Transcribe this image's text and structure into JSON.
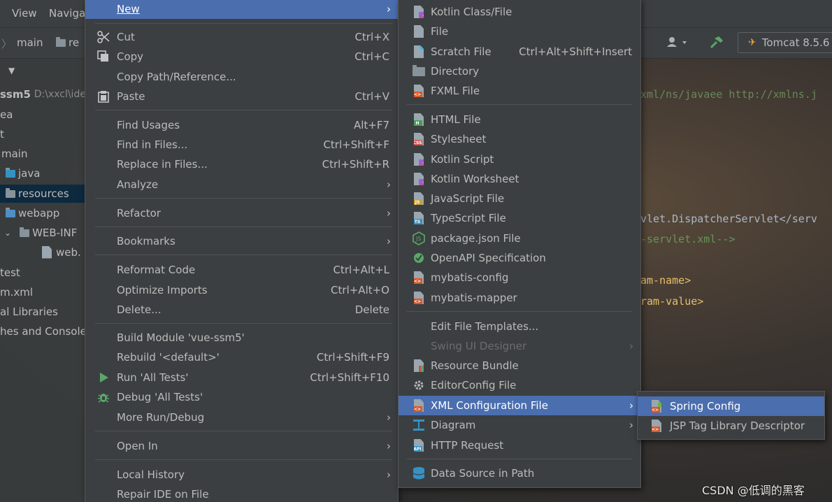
{
  "ide": {
    "menubar": {
      "view": "View",
      "navigate": "Naviga"
    },
    "breadcrumb": {
      "main": "main",
      "resources": "re"
    },
    "run_config": "Tomcat 8.5.6",
    "project_tree": [
      {
        "label": "ssm5",
        "hint": "D:\\xxcl\\idea"
      },
      {
        "label": "ea"
      },
      {
        "label": "t"
      },
      {
        "label": "main"
      },
      {
        "label": "java"
      },
      {
        "label": "resources"
      },
      {
        "label": "webapp"
      },
      {
        "label": "WEB-INF"
      },
      {
        "label": "web."
      },
      {
        "label": "test"
      },
      {
        "label": "m.xml"
      },
      {
        "label": "al Libraries"
      },
      {
        "label": "hes and Console"
      }
    ],
    "code_lines": [
      {
        "text": "xml/ns/javaee http://xmlns.j",
        "cls": "c-str"
      },
      {
        "text": "vlet.DispatcherServlet</serv",
        "cls": "c-txt"
      },
      {
        "text": "-servlet.xml-->",
        "cls": "c-com"
      },
      {
        "text": "am-name>",
        "cls": "c-tag"
      },
      {
        "text": "ram-value>",
        "cls": "c-tag"
      }
    ]
  },
  "context_menu": {
    "items": [
      {
        "label": "New",
        "submenu": true
      },
      {
        "label": "Cut",
        "shortcut": "Ctrl+X",
        "icon": "scissors-icon"
      },
      {
        "label": "Copy",
        "shortcut": "Ctrl+C",
        "icon": "copy-icon"
      },
      {
        "label": "Copy Path/Reference..."
      },
      {
        "label": "Paste",
        "shortcut": "Ctrl+V",
        "icon": "paste-icon"
      },
      {
        "label": "Find Usages",
        "shortcut": "Alt+F7"
      },
      {
        "label": "Find in Files...",
        "shortcut": "Ctrl+Shift+F"
      },
      {
        "label": "Replace in Files...",
        "shortcut": "Ctrl+Shift+R"
      },
      {
        "label": "Analyze",
        "submenu": true
      },
      {
        "label": "Refactor",
        "submenu": true
      },
      {
        "label": "Bookmarks",
        "submenu": true
      },
      {
        "label": "Reformat Code",
        "shortcut": "Ctrl+Alt+L"
      },
      {
        "label": "Optimize Imports",
        "shortcut": "Ctrl+Alt+O"
      },
      {
        "label": "Delete...",
        "shortcut": "Delete"
      },
      {
        "label": "Build Module 'vue-ssm5'"
      },
      {
        "label": "Rebuild '<default>'",
        "shortcut": "Ctrl+Shift+F9"
      },
      {
        "label": "Run 'All Tests'",
        "shortcut": "Ctrl+Shift+F10",
        "icon": "run-icon"
      },
      {
        "label": "Debug 'All Tests'",
        "icon": "debug-icon"
      },
      {
        "label": "More Run/Debug",
        "submenu": true
      },
      {
        "label": "Open In",
        "submenu": true
      },
      {
        "label": "Local History",
        "submenu": true
      },
      {
        "label": "Repair IDE on File"
      }
    ]
  },
  "new_submenu": {
    "items": [
      {
        "label": "Kotlin Class/File"
      },
      {
        "label": "File"
      },
      {
        "label": "Scratch File",
        "shortcut": "Ctrl+Alt+Shift+Insert"
      },
      {
        "label": "Directory"
      },
      {
        "label": "FXML File"
      },
      {
        "label": "HTML File"
      },
      {
        "label": "Stylesheet"
      },
      {
        "label": "Kotlin Script"
      },
      {
        "label": "Kotlin Worksheet"
      },
      {
        "label": "JavaScript File"
      },
      {
        "label": "TypeScript File"
      },
      {
        "label": "package.json File"
      },
      {
        "label": "OpenAPI Specification"
      },
      {
        "label": "mybatis-config"
      },
      {
        "label": "mybatis-mapper"
      },
      {
        "label": "Edit File Templates..."
      },
      {
        "label": "Swing UI Designer",
        "submenu": true
      },
      {
        "label": "Resource Bundle"
      },
      {
        "label": "EditorConfig File"
      },
      {
        "label": "XML Configuration File",
        "submenu": true
      },
      {
        "label": "Diagram",
        "submenu": true
      },
      {
        "label": "HTTP Request"
      },
      {
        "label": "Data Source in Path"
      }
    ]
  },
  "xml_submenu": {
    "items": [
      {
        "label": "Spring Config"
      },
      {
        "label": "JSP Tag Library Descriptor"
      }
    ]
  },
  "colors": {
    "highlight": "#4b6eaf",
    "menu_bg": "#3c3f41",
    "text": "#bbbbbb"
  },
  "watermark": "CSDN @低调的黑客"
}
